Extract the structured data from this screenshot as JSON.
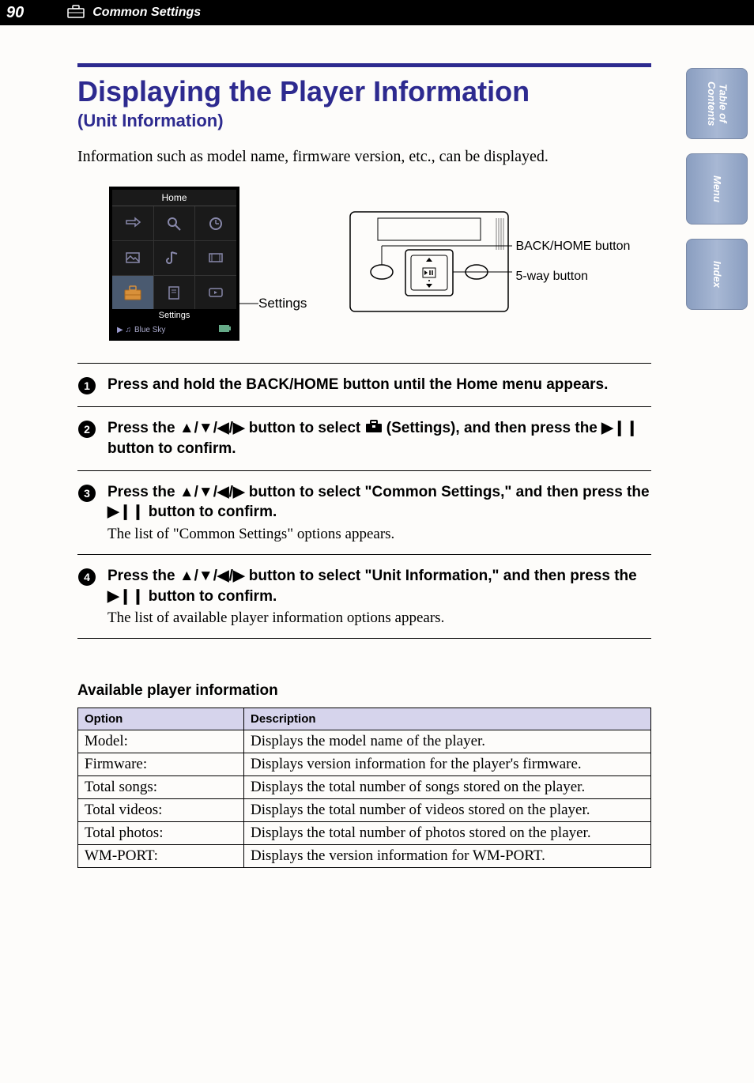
{
  "header": {
    "page_number": "90",
    "chapter_title": "Common Settings"
  },
  "side_tabs": {
    "tab_contents": "Table of\nContents",
    "tab_menu": "Menu",
    "tab_index": "Index"
  },
  "main": {
    "title": "Displaying the Player Information",
    "subtitle": "(Unit Information)",
    "intro": "Information such as model name, firmware version, etc., can be displayed."
  },
  "screen": {
    "title": "Home",
    "footer_label": "Settings",
    "now_playing": "Blue Sky",
    "annotation": "Settings"
  },
  "diagram": {
    "label_back_home": "BACK/HOME button",
    "label_5way": "5-way button"
  },
  "steps": [
    {
      "text_before": "Press and hold the BACK/HOME button until the Home menu appears.",
      "note": ""
    },
    {
      "text_before": "Press the ",
      "dpad": "▲/▼/◀/▶",
      "text_mid": " button to select ",
      "icon": "toolbox",
      "text_after": " (Settings), and then press the ",
      "play": "▶❙❙",
      "text_end": " button to confirm.",
      "note": ""
    },
    {
      "text_before": "Press the ",
      "dpad": "▲/▼/◀/▶",
      "text_mid": " button to select \"Common Settings,\" and then press the ",
      "play": "▶❙❙",
      "text_end": " button to confirm.",
      "note": "The list of \"Common Settings\" options appears."
    },
    {
      "text_before": "Press the ",
      "dpad": "▲/▼/◀/▶",
      "text_mid": " button to select \"Unit Information,\" and then press the ",
      "play": "▶❙❙",
      "text_end": " button to confirm.",
      "note": "The list of available player information options appears."
    }
  ],
  "table": {
    "heading": "Available player information",
    "col_option": "Option",
    "col_description": "Description",
    "rows": [
      {
        "option": "Model:",
        "description": "Displays the model name of the player."
      },
      {
        "option": "Firmware:",
        "description": "Displays version information for the player's firmware."
      },
      {
        "option": "Total songs:",
        "description": "Displays the total number of songs stored on the player."
      },
      {
        "option": "Total videos:",
        "description": "Displays the total number of videos stored on the player."
      },
      {
        "option": "Total photos:",
        "description": "Displays the total number of photos stored on the player."
      },
      {
        "option": "WM-PORT:",
        "description": "Displays the version information for WM-PORT."
      }
    ]
  }
}
